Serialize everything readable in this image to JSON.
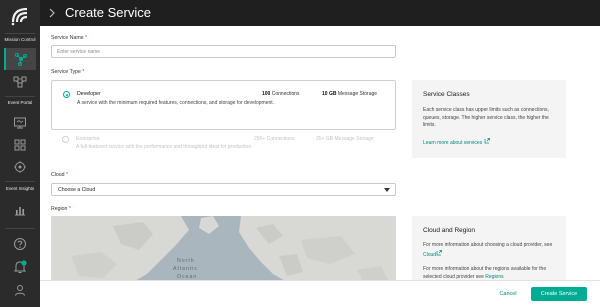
{
  "header": {
    "title": "Create Service"
  },
  "sidebar": {
    "captions": {
      "mission_control": "Mission Control",
      "event_portal": "Event Portal",
      "event_insights": "Event Insights"
    },
    "notification_count": "1"
  },
  "form": {
    "service_name": {
      "label": "Service Name",
      "placeholder": "Enter service name"
    },
    "service_type": {
      "label": "Service Type",
      "options": [
        {
          "name": "Developer",
          "connections": "100",
          "connections_unit": "Connections",
          "storage": "10 GB",
          "storage_unit": "Message Storage",
          "description": "A service with the minimum required features, connections, and storage for development.",
          "selected": true
        },
        {
          "name": "Enterprise",
          "connections": "250+",
          "connections_unit": "Connections",
          "storage": "25+ GB",
          "storage_unit": "Message Storage",
          "description": "A full-featured service with the performance and throughput ideal for production.",
          "selected": false
        }
      ]
    },
    "cloud": {
      "label": "Cloud",
      "value": "Choose a Cloud"
    },
    "region": {
      "label": "Region",
      "map_labels": {
        "north": "North",
        "atlantic": "Atlantic",
        "ocean": "Ocean"
      }
    },
    "required_marker": "*"
  },
  "panels": {
    "service_classes": {
      "title": "Service Classes",
      "text": "Each service class has upper limits such as connections, queues, storage. The higher service class, the higher the limits.",
      "link": "Learn more about services"
    },
    "cloud_region": {
      "title": "Cloud and Region",
      "text1": "For more information about choosing a cloud provider, see",
      "link1": "Cloud",
      "text2": "For more information about the regions available for the selected cloud provider see",
      "link2": "Regions"
    }
  },
  "footer": {
    "cancel_label": "Cancel",
    "create_label": "Create Service"
  },
  "colors": {
    "accent": "#00ad93",
    "link": "#00897b",
    "sidebar_bg": "#2b2b2b",
    "header_bg": "#1f1f1f"
  }
}
